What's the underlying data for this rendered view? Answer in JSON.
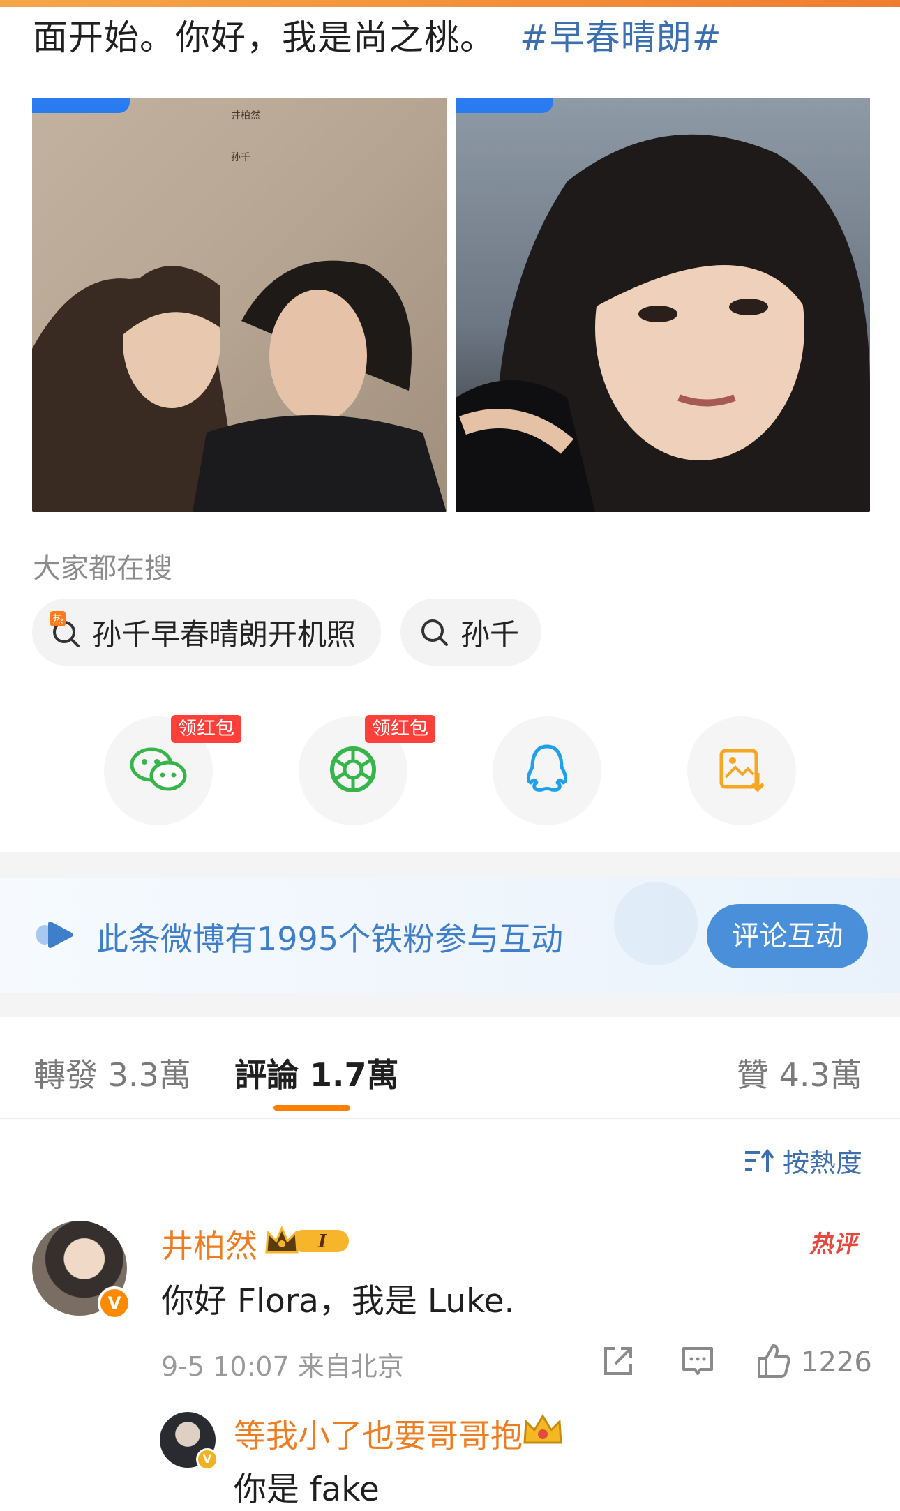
{
  "post": {
    "text": "面开始。你好，我是尚之桃。",
    "hashtag": "#早春晴朗#"
  },
  "search": {
    "title": "大家都在搜",
    "chips": [
      {
        "label": "孙千早春晴朗开机照",
        "icon": "hot-search-icon",
        "hot_label": "热"
      },
      {
        "label": "孙千",
        "icon": "search-icon"
      }
    ]
  },
  "share": {
    "buttons": [
      {
        "name": "wechat",
        "icon": "wechat-icon",
        "badge": "领红包"
      },
      {
        "name": "moments",
        "icon": "moments-icon",
        "badge": "领红包"
      },
      {
        "name": "qq",
        "icon": "qq-icon"
      },
      {
        "name": "save-image",
        "icon": "save-image-icon"
      }
    ]
  },
  "fan_banner": {
    "text": "此条微博有1995个铁粉参与互动",
    "button": "评论互动"
  },
  "tabs": [
    {
      "label": "轉發 3.3萬"
    },
    {
      "label": "評論 1.7萬",
      "active": true
    },
    {
      "label": "贊 4.3萬"
    }
  ],
  "sort": {
    "label": "按熱度"
  },
  "comment": {
    "user": "井柏然",
    "hot_tag": "热评",
    "text": "你好 Flora，我是 Luke.",
    "meta": "9-5 10:07 来自北京",
    "likes": "1226",
    "vip_level": "I"
  },
  "reply": {
    "user": "等我小了也要哥哥抱",
    "text": "你是 fake"
  },
  "colors": {
    "accent": "#ff8000",
    "link": "#3b6fb0",
    "username": "#ee7d22",
    "red_badge": "#ff3f3a",
    "fan_blue": "#4a8fd9"
  }
}
